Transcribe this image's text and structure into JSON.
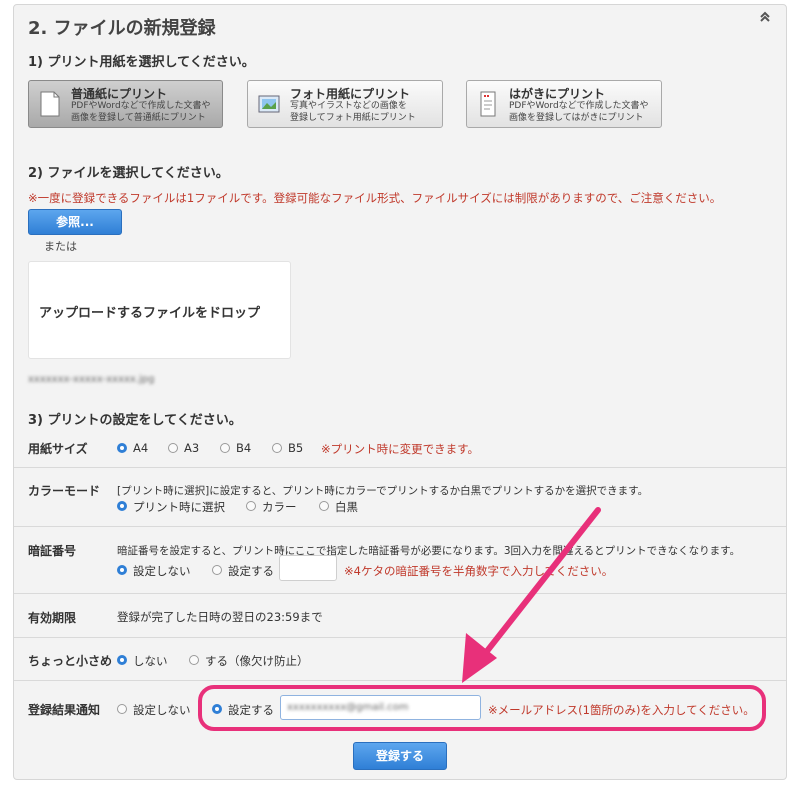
{
  "section": {
    "title": "2. ファイルの新規登録"
  },
  "step1": {
    "heading": "1) プリント用紙を選択してください。",
    "options": [
      {
        "title": "普通紙にプリント",
        "desc1": "PDFやWordなどで作成した文書や",
        "desc2": "画像を登録して普通紙にプリント"
      },
      {
        "title": "フォト用紙にプリント",
        "desc1": "写真やイラストなどの画像を",
        "desc2": "登録してフォト用紙にプリント"
      },
      {
        "title": "はがきにプリント",
        "desc1": "PDFやWordなどで作成した文書や",
        "desc2": "画像を登録してはがきにプリント"
      }
    ]
  },
  "step2": {
    "heading": "2) ファイルを選択してください。",
    "notice": "※一度に登録できるファイルは1ファイルです。登録可能なファイル形式、ファイルサイズには制限がありますので、ご注意ください。",
    "browse_label": "参照...",
    "or_label": "または",
    "drop_label": "アップロードするファイルをドロップ",
    "filename": "xxxxxxx-xxxxx-xxxxx.jpg"
  },
  "step3": {
    "heading": "3) プリントの設定をしてください。",
    "paper_size": {
      "label": "用紙サイズ",
      "options": [
        "A4",
        "A3",
        "B4",
        "B5"
      ],
      "selected": "A4",
      "note": "※プリント時に変更できます。"
    },
    "color_mode": {
      "label": "カラーモード",
      "desc": "[プリント時に選択]に設定すると、プリント時にカラーでプリントするか白黒でプリントするかを選択できます。",
      "options": [
        "プリント時に選択",
        "カラー",
        "白黒"
      ],
      "selected": "プリント時に選択"
    },
    "pin": {
      "label": "暗証番号",
      "desc": "暗証番号を設定すると、プリント時にここで指定した暗証番号が必要になります。3回入力を間違えるとプリントできなくなります。",
      "options": [
        "設定しない",
        "設定する"
      ],
      "selected": "設定しない",
      "value": "",
      "note": "※4ケタの暗証番号を半角数字で入力してください。"
    },
    "expiry": {
      "label": "有効期限",
      "value": "登録が完了した日時の翌日の23:59まで"
    },
    "shrink": {
      "label": "ちょっと小さめ",
      "options": [
        "しない",
        "する（像欠け防止）"
      ],
      "selected": "しない"
    },
    "notify": {
      "label": "登録結果通知",
      "options": [
        "設定しない",
        "設定する"
      ],
      "selected": "設定する",
      "email_value": "xxxxxxxxxx@gmail.com",
      "note": "※メールアドレス(1箇所のみ)を入力してください。"
    }
  },
  "submit_label": "登録する",
  "colors": {
    "accent_blue": "#2f7fd6",
    "warning_red": "#c0392b",
    "highlight_pink": "#e8307a"
  },
  "icons": {
    "collapse": "double-chevron-up-icon",
    "plain_paper": "document-icon",
    "photo_paper": "photo-icon",
    "postcard": "postcard-icon",
    "annotation": "arrow-annotation"
  }
}
